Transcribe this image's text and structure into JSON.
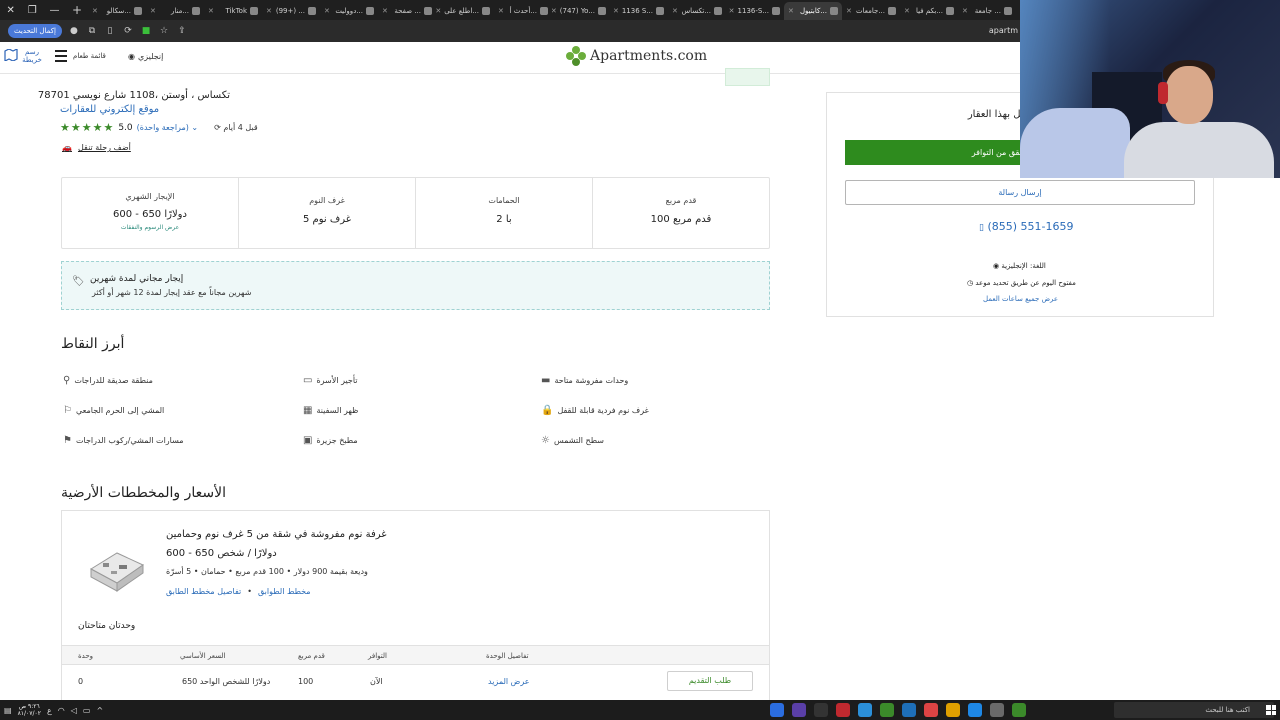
{
  "browser": {
    "tabs": [
      "سكالو...",
      "منار...",
      "TikTok",
      "(99+) ...",
      "دووليت...",
      "صفحة ...",
      "اطلع على...",
      "أحدث أ...",
      "(747) Yo...",
      "1136 S...",
      "تكساس...",
      "1136-S...",
      "كابتيول...",
      "جامعات...",
      "بكم فيا...",
      "جامعة ..."
    ],
    "active_tab_index": 12,
    "update_button": "إكمال التحديث",
    "url": "apartm"
  },
  "header": {
    "map_label": "رسم خريطة",
    "menu_label": "قائمة طعام",
    "language_label": "إنجليزي",
    "logo_text": "Apartments.com"
  },
  "listing": {
    "address": "78701 تكساس ، أوستن ،1108 شارع نويسي",
    "website_link": "موقع إلكتروني للعقارات",
    "rating_value": "5.0",
    "reviews_link": "(مراجعة واحدة)",
    "updated": "قبل 4 أيام",
    "add_trip": "أضف رحلة تنقل"
  },
  "stats": [
    {
      "label": "الإيجار الشهري",
      "value": "600 - 650 دولارًا",
      "sub": "عرض الرسوم والنفقات"
    },
    {
      "label": "غرف النوم",
      "value": "5 غرف نوم",
      "sub": ""
    },
    {
      "label": "الحمامات",
      "value": "2 با",
      "sub": ""
    },
    {
      "label": "قدم مربع",
      "value": "100 قدم مربع",
      "sub": ""
    }
  ],
  "promo": {
    "title": "إيجار مجاني لمدة شهرين",
    "detail": "شهرين مجاناً مع عقد إيجار لمدة 12 شهر أو أكثر"
  },
  "highlights": {
    "heading": "أبرز النقاط",
    "items": [
      {
        "label": "منطقة صديقة للدراجات",
        "icon": "bike-icon"
      },
      {
        "label": "تأجير الأسرة",
        "icon": "bed-icon"
      },
      {
        "label": "وحدات مفروشة متاحة",
        "icon": "sofa-icon"
      },
      {
        "label": "المشي إلى الحرم الجامعي",
        "icon": "walk-icon"
      },
      {
        "label": "ظهر السفينة",
        "icon": "building-icon"
      },
      {
        "label": "غرف نوم فردية قابلة للقفل",
        "icon": "lock-icon"
      },
      {
        "label": "مسارات المشي/ركوب الدراجات",
        "icon": "trail-icon"
      },
      {
        "label": "مطبخ جزيرة",
        "icon": "kitchen-icon"
      },
      {
        "label": "سطح التشمس",
        "icon": "sundeck-icon"
      }
    ]
  },
  "pricing": {
    "heading": "الأسعار والمخططات الأرضية",
    "plan_title": "غرفة نوم مفروشة في شقة من 5 غرف نوم وحمامين",
    "plan_price": "600 - 650 دولارًا / شخص",
    "plan_meta": "وديعة بقيمة 900 دولار  •  100 قدم مربع  •  حمامان  •  5 أسرّة",
    "link_details": "تفاصيل مخطط الطابق",
    "link_plans": "مخطط الطوابق",
    "units_available": "وحدتان متاحتان",
    "table_headers": [
      "وحدة",
      "السعر الأساسي",
      "قدم مربع",
      "التوافر",
      "تفاصيل الوحدة"
    ],
    "row": {
      "unit": "0",
      "price": "650 دولارًا للشخص الواحد",
      "sqft": "100",
      "availability": "الآن",
      "details": "عرض المزيد",
      "apply": "طلب التقديم"
    }
  },
  "contact": {
    "title": "اتصل بهذا العقار",
    "check_button": "تحقق من التوافر",
    "message_button": "إرسال رسالة",
    "phone": "(855) 551-1659",
    "language": "اللغة: الإنجليزية",
    "open_status": "مفتوح اليوم عن طريق تحديد موعد",
    "hours_link": "عرض جميع ساعات العمل"
  },
  "taskbar": {
    "search_placeholder": "اكتب هنا للبحث",
    "time": "٩:٢٦ ص",
    "date": "٨١/٠٧/٠٢"
  },
  "colors": {
    "brand_green": "#2e8b1e",
    "link_blue": "#2a6bb8",
    "promo_bg": "#eef8f8"
  }
}
